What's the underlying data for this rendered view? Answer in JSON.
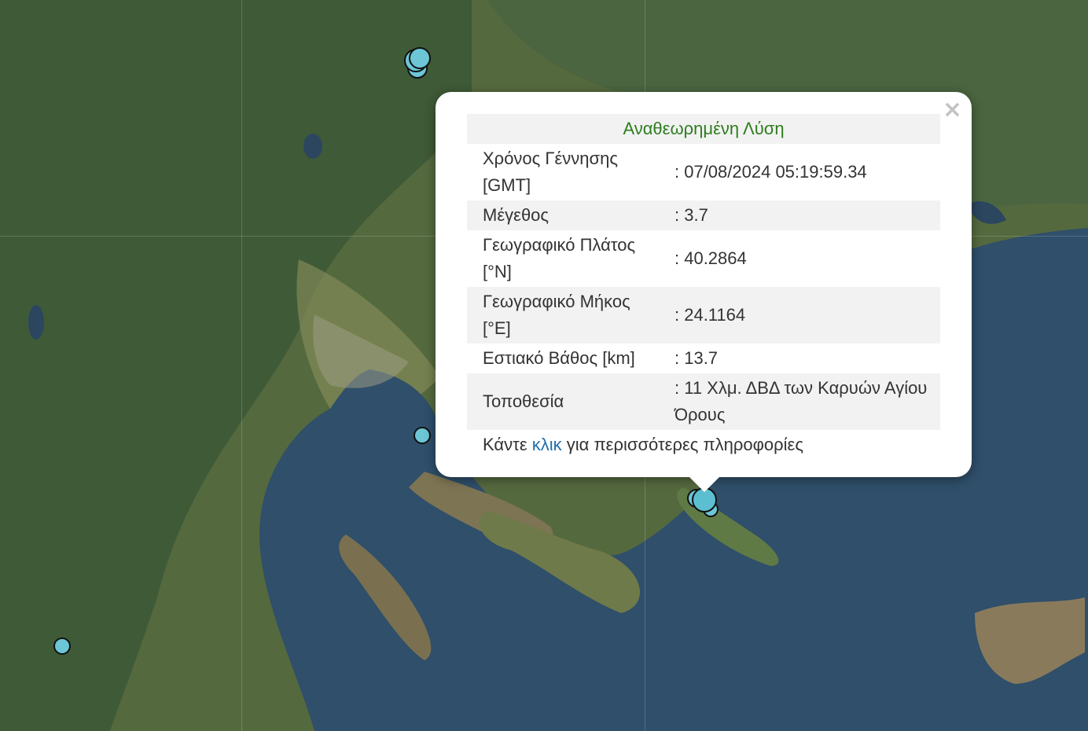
{
  "popup": {
    "title": "Αναθεωρημένη Λύση",
    "close": "×",
    "rows": [
      {
        "label": "Χρόνος Γέννησης [GMT]",
        "value": ": 07/08/2024 05:19:59.34"
      },
      {
        "label": "Μέγεθος",
        "value": ": 3.7"
      },
      {
        "label": "Γεωγραφικό Πλάτος [°N]",
        "value": ": 40.2864"
      },
      {
        "label": "Γεωγραφικό Μήκος [°E]",
        "value": ": 24.1164"
      },
      {
        "label": "Εστιακό Βάθος [km]",
        "value": ": 13.7"
      },
      {
        "label": "Τοποθεσία",
        "value": ": 11 Χλμ. ΔΒΔ των Καρυών Αγίου Όρους"
      }
    ],
    "more_prefix": "Κάντε",
    "more_link": "κλικ",
    "more_suffix": "για περισσότερες πληροφορίες"
  },
  "colors": {
    "marker": "#6cc6d6",
    "title": "#2e7d1e",
    "link": "#1f6fae"
  }
}
